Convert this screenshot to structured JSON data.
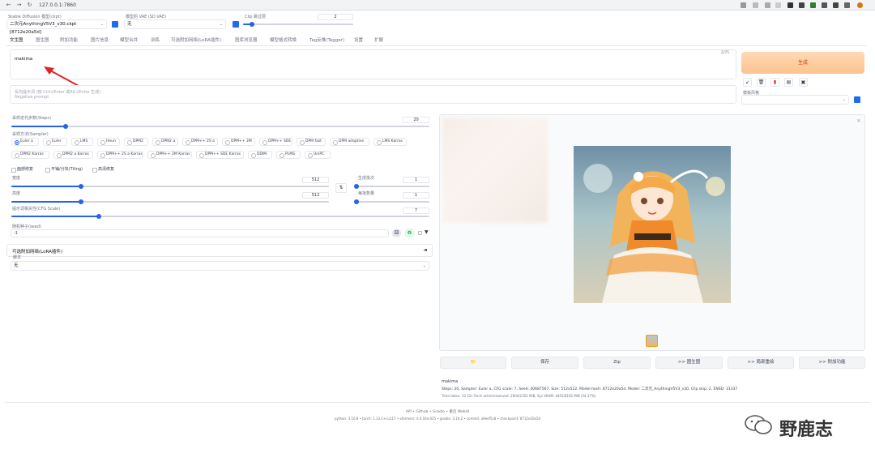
{
  "browser": {
    "url": "127.0.0.1:7860",
    "back_icon": "arrow-left-icon",
    "forward_icon": "arrow-right-icon",
    "reload_icon": "reload-icon"
  },
  "top": {
    "model_label": "Stable Diffusion 模型(ckpt)",
    "model_value": "二次元AnythingV5V3_v30.ckpt [8712e20a5d]",
    "vae_label": "模型的 VAE (SD VAE)",
    "vae_value": "无",
    "clip_label": "Clip 跳过层",
    "clip_value": "2",
    "clip_fraction": 0.08
  },
  "tabs": [
    "文生图",
    "图生图",
    "附加功能",
    "图片信息",
    "模型合并",
    "训练",
    "可选附加网络(LoRA插件)",
    "图库浏览器",
    "模型格式转换",
    "Tag反推(Tagger)",
    "设置",
    "扩展"
  ],
  "prompt": {
    "value": "makima",
    "counter": "2/75",
    "negative_placeholder_line1": "反向提示词 (按 Ctrl+Enter 或Alt+Enter 生成)",
    "negative_placeholder_line2": "Negative prompt"
  },
  "generate_label": "生成",
  "tools": {
    "icons": [
      "arrow-icon",
      "trash-icon",
      "clipboard-red-icon",
      "clipboard-icon",
      "save-icon"
    ],
    "style_label": "模板风格"
  },
  "steps": {
    "label": "采样迭代步数(Steps)",
    "value": "20",
    "fraction": 0.13
  },
  "sampler": {
    "label": "采样方法(Sampler)",
    "row1": [
      "Euler a",
      "Euler",
      "LMS",
      "Heun",
      "DPM2",
      "DPM2 a",
      "DPM++ 2S a",
      "DPM++ 2M",
      "DPM++ SDE",
      "DPM fast",
      "DPM adaptive",
      "LMS Karras"
    ],
    "row2": [
      "DPM2 Karras",
      "DPM2 a Karras",
      "DPM++ 2S a Karras",
      "DPM++ 2M Karras",
      "DPM++ SDE Karras",
      "DDIM",
      "PLMS",
      "UniPC"
    ],
    "selected": "Euler a"
  },
  "checks": [
    "面部修复",
    "平铺/分块(Tiling)",
    "高清修复"
  ],
  "width": {
    "label": "宽度",
    "value": "512",
    "fraction": 0.22
  },
  "height": {
    "label": "高度",
    "value": "512",
    "fraction": 0.22
  },
  "batch_count": {
    "label": "生成批次",
    "value": "1",
    "fraction": 0.0
  },
  "batch_size": {
    "label": "每批数量",
    "value": "1",
    "fraction": 0.0
  },
  "cfg": {
    "label": "提示词相关性(CFG Scale)",
    "value": "7",
    "fraction": 0.21
  },
  "seed": {
    "label": "随机种子(seed)",
    "value": "-1"
  },
  "lora": {
    "label": "可选附加网络(LoRA插件)",
    "caret": "◄"
  },
  "script": {
    "label": "脚本",
    "value": "无"
  },
  "output": {
    "close": "×",
    "buttons": [
      "📁",
      "保存",
      "Zip",
      ">> 图生图",
      ">> 局部重绘",
      ">> 附加功能"
    ],
    "info_prompt": "makima",
    "info_params": "Steps: 20, Sampler: Euler a, CFG scale: 7, Seed: 40687567, Size: 512x512, Model hash: 8712e20a5d, Model: 二次元_AnythingV5V3_v30, Clip skip: 2, ENSD: 31337",
    "info_time": "Time taken: 13.52s  Torch active/reserved: 2004/2352 MiB, Sys VRAM: 4455/8192 MiB (54.37%)"
  },
  "footer": {
    "links": "API  •  Github  •  Gradio  •  重启 WebUI",
    "versions": "python: 3.10.8  •  torch: 1.13.1+cu117  •  xformers: 0.0.16rc425  •  gradio: 3.16.2  •  commit: a9eef5c8  •  checkpoint: 8712e20a5d"
  },
  "watermark": "野鹿志",
  "colors": {
    "accent": "#2563eb",
    "generate": "#fcc38e",
    "arrow": "#e02424"
  }
}
